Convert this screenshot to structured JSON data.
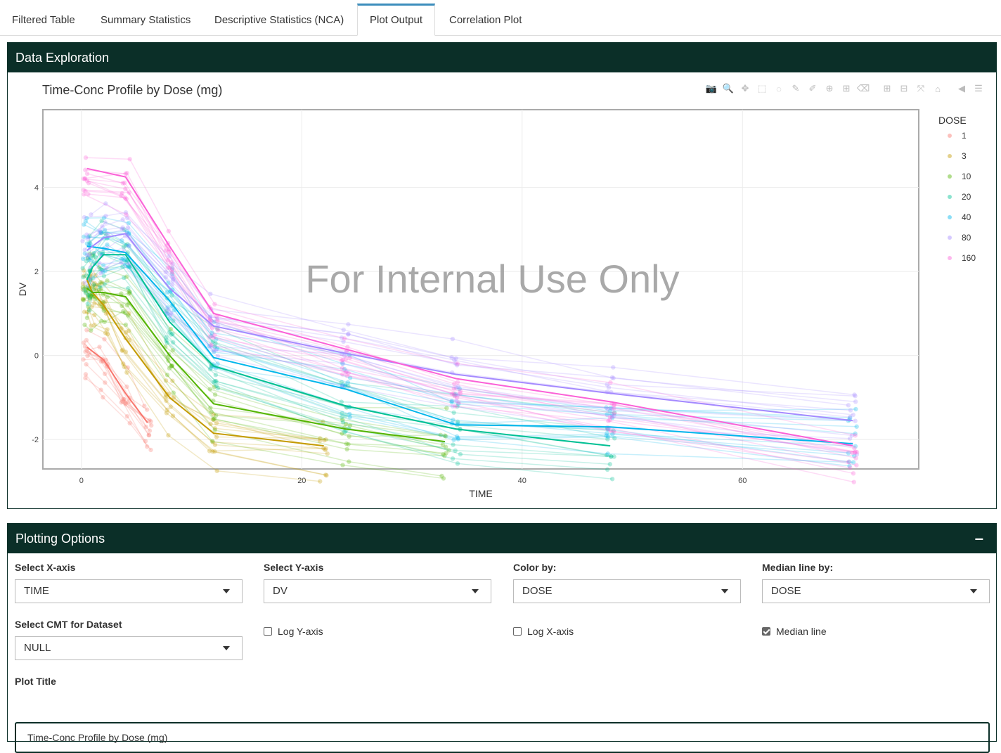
{
  "tabs": [
    {
      "label": "Filtered Table"
    },
    {
      "label": "Summary Statistics"
    },
    {
      "label": "Descriptive Statistics (NCA)"
    },
    {
      "label": "Plot Output"
    },
    {
      "label": "Correlation Plot"
    }
  ],
  "data_box": {
    "title": "Data Exploration"
  },
  "options_box": {
    "title": "Plotting Options",
    "collapse_label": "–"
  },
  "chart_data": {
    "type": "line",
    "title": "Time-Conc Profile by Dose (mg)",
    "xlabel": "TIME",
    "ylabel": "DV",
    "xlim": [
      -3.5,
      76
    ],
    "ylim": [
      -2.7,
      5.85
    ],
    "xticks": [
      0,
      20,
      40,
      60
    ],
    "yticks": [
      -2,
      0,
      2,
      4
    ],
    "grid": true,
    "watermark": "For Internal Use Only",
    "legend_title": "DOSE",
    "legend_position": "right",
    "series": [
      {
        "name": "1",
        "color": "#f8766d",
        "median": [
          [
            0.5,
            0.2
          ],
          [
            2,
            -0.1
          ],
          [
            4,
            -0.9
          ],
          [
            6,
            -1.6
          ]
        ]
      },
      {
        "name": "3",
        "color": "#c49a00",
        "median": [
          [
            0.5,
            1.8
          ],
          [
            1,
            1.5
          ],
          [
            2,
            1.2
          ],
          [
            4,
            0.4
          ],
          [
            8,
            -1.0
          ],
          [
            12,
            -1.85
          ],
          [
            22,
            -2.15
          ]
        ]
      },
      {
        "name": "10",
        "color": "#53b400",
        "median": [
          [
            0.5,
            1.6
          ],
          [
            1,
            1.5
          ],
          [
            2,
            1.5
          ],
          [
            4,
            1.4
          ],
          [
            8,
            0.0
          ],
          [
            12,
            -1.15
          ],
          [
            24,
            -1.75
          ],
          [
            33,
            -2.05
          ]
        ]
      },
      {
        "name": "20",
        "color": "#00c094",
        "median": [
          [
            0.5,
            1.8
          ],
          [
            1,
            2.1
          ],
          [
            2,
            2.4
          ],
          [
            4,
            2.4
          ],
          [
            8,
            0.8
          ],
          [
            12,
            -0.25
          ],
          [
            24,
            -1.2
          ],
          [
            34,
            -1.75
          ],
          [
            48,
            -2.15
          ]
        ]
      },
      {
        "name": "40",
        "color": "#00b6eb",
        "median": [
          [
            0.5,
            2.6
          ],
          [
            2,
            2.55
          ],
          [
            4,
            2.45
          ],
          [
            8,
            1.3
          ],
          [
            12,
            -0.05
          ],
          [
            24,
            -0.8
          ],
          [
            34,
            -1.65
          ],
          [
            48,
            -1.7
          ],
          [
            70,
            -2.1
          ]
        ]
      },
      {
        "name": "80",
        "color": "#a58aff",
        "median": [
          [
            0.5,
            2.5
          ],
          [
            2,
            2.8
          ],
          [
            4,
            2.9
          ],
          [
            8,
            1.6
          ],
          [
            12,
            0.7
          ],
          [
            24,
            0.05
          ],
          [
            34,
            -0.45
          ],
          [
            48,
            -0.9
          ],
          [
            70,
            -1.55
          ]
        ]
      },
      {
        "name": "160",
        "color": "#fb61d7",
        "median": [
          [
            0.5,
            4.45
          ],
          [
            4,
            4.25
          ],
          [
            8,
            2.6
          ],
          [
            12,
            1.0
          ],
          [
            24,
            0.15
          ],
          [
            34,
            -0.55
          ],
          [
            48,
            -1.1
          ],
          [
            70,
            -2.15
          ]
        ]
      }
    ]
  },
  "modebar": [
    {
      "icon": "camera-icon",
      "glyph": "📷"
    },
    {
      "icon": "zoom-icon",
      "glyph": "🔍"
    },
    {
      "icon": "pan-icon",
      "glyph": "✥"
    },
    {
      "icon": "box-select-icon",
      "glyph": "⬚"
    },
    {
      "icon": "lasso-icon",
      "glyph": "◌"
    },
    {
      "icon": "draw-open-path-icon",
      "glyph": "✎"
    },
    {
      "icon": "draw-closed-path-icon",
      "glyph": "✐"
    },
    {
      "icon": "draw-circle-icon",
      "glyph": "⊕"
    },
    {
      "icon": "draw-rect-icon",
      "glyph": "⊞"
    },
    {
      "icon": "erase-shape-icon",
      "glyph": "⌫"
    },
    {
      "icon": "zoom-in-icon",
      "glyph": "⊞"
    },
    {
      "icon": "zoom-out-icon",
      "glyph": "⊟"
    },
    {
      "icon": "autoscale-icon",
      "glyph": "⤧"
    },
    {
      "icon": "reset-axes-icon",
      "glyph": "⌂"
    },
    {
      "icon": "spike-lines-icon",
      "glyph": "◀"
    },
    {
      "icon": "compare-hover-icon",
      "glyph": "☰"
    }
  ],
  "form": {
    "x_axis": {
      "label": "Select X-axis",
      "value": "TIME"
    },
    "y_axis": {
      "label": "Select Y-axis",
      "value": "DV"
    },
    "color_by": {
      "label": "Color by:",
      "value": "DOSE"
    },
    "median_by": {
      "label": "Median line by:",
      "value": "DOSE"
    },
    "cmt": {
      "label": "Select CMT for Dataset",
      "value": "NULL"
    },
    "log_y": {
      "label": "Log Y-axis",
      "checked": false
    },
    "log_x": {
      "label": "Log X-axis",
      "checked": false
    },
    "median_line": {
      "label": "Median line",
      "checked": true
    },
    "plot_title": {
      "label": "Plot Title",
      "value": "Time-Conc Profile by Dose (mg)"
    }
  }
}
